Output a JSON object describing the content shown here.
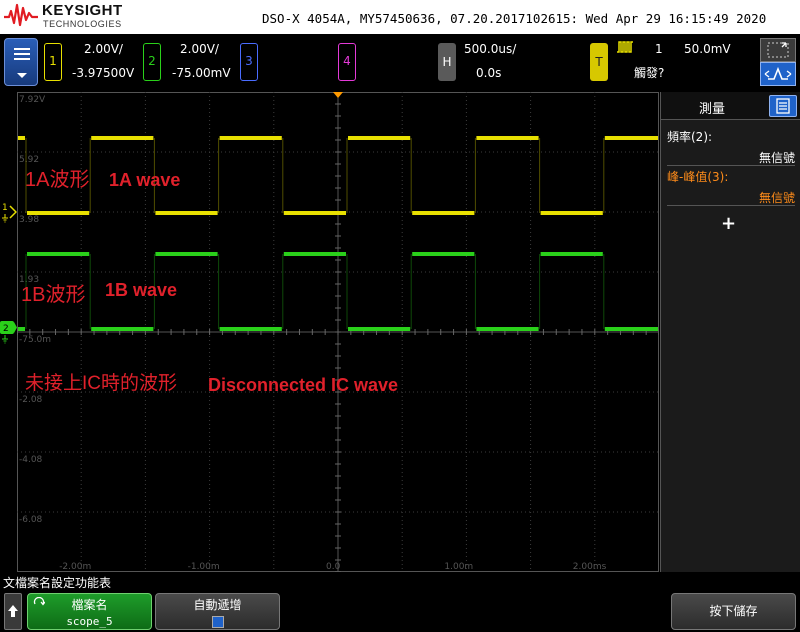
{
  "header": {
    "brand": "KEYSIGHT",
    "brand_sub": "TECHNOLOGIES",
    "info": "DSO-X 4054A, MY57450636, 07.20.2017102615: Wed Apr 29 16:15:49 2020"
  },
  "channels": {
    "ch1": {
      "label": "1",
      "scale": "2.00V/",
      "offset": "-3.97500V",
      "color": "#e8e000"
    },
    "ch2": {
      "label": "2",
      "scale": "2.00V/",
      "offset": "-75.00mV",
      "color": "#2ad11a"
    },
    "ch3": {
      "label": "3",
      "color": "#4a6cff"
    },
    "ch4": {
      "label": "4",
      "color": "#e43ad8"
    }
  },
  "horizontal": {
    "label": "H",
    "timebase": "500.0us/",
    "delay": "0.0s"
  },
  "trigger": {
    "label": "T",
    "source": "1",
    "level": "50.0mV",
    "status": "觸發?"
  },
  "graticule": {
    "y_labels": [
      "7.92V",
      "5.92",
      "3.98",
      "1.93",
      "-75.0m",
      "-2.08",
      "-4.08",
      "-6.08"
    ],
    "x_labels": [
      "-2.00m",
      "-1.00m",
      "0.0",
      "1.00m",
      "2.00ms"
    ],
    "ch1_marker": "1",
    "ch2_marker": "2"
  },
  "annotations": {
    "wave_1a_zh": "1A波形",
    "wave_1a_en": "1A wave",
    "wave_1b_zh": "1B波形",
    "wave_1b_en": "1B wave",
    "disc_zh": "未接上IC時的波形",
    "disc_en": "Disconnected IC wave",
    "color": "#e0212b"
  },
  "measure": {
    "title": "測量",
    "items": [
      {
        "name": "頻率(2):",
        "value": "無信號",
        "color": "#ffffff"
      },
      {
        "name": "峰-峰值(3):",
        "value": "無信號",
        "color": "#ff8c1a"
      }
    ],
    "add": "+"
  },
  "softkeys": {
    "title": "文檔案名設定功能表",
    "filename_label": "檔案名",
    "filename_value": "scope_5",
    "auto_inc_label": "自動遞增",
    "save_label": "按下儲存"
  }
}
